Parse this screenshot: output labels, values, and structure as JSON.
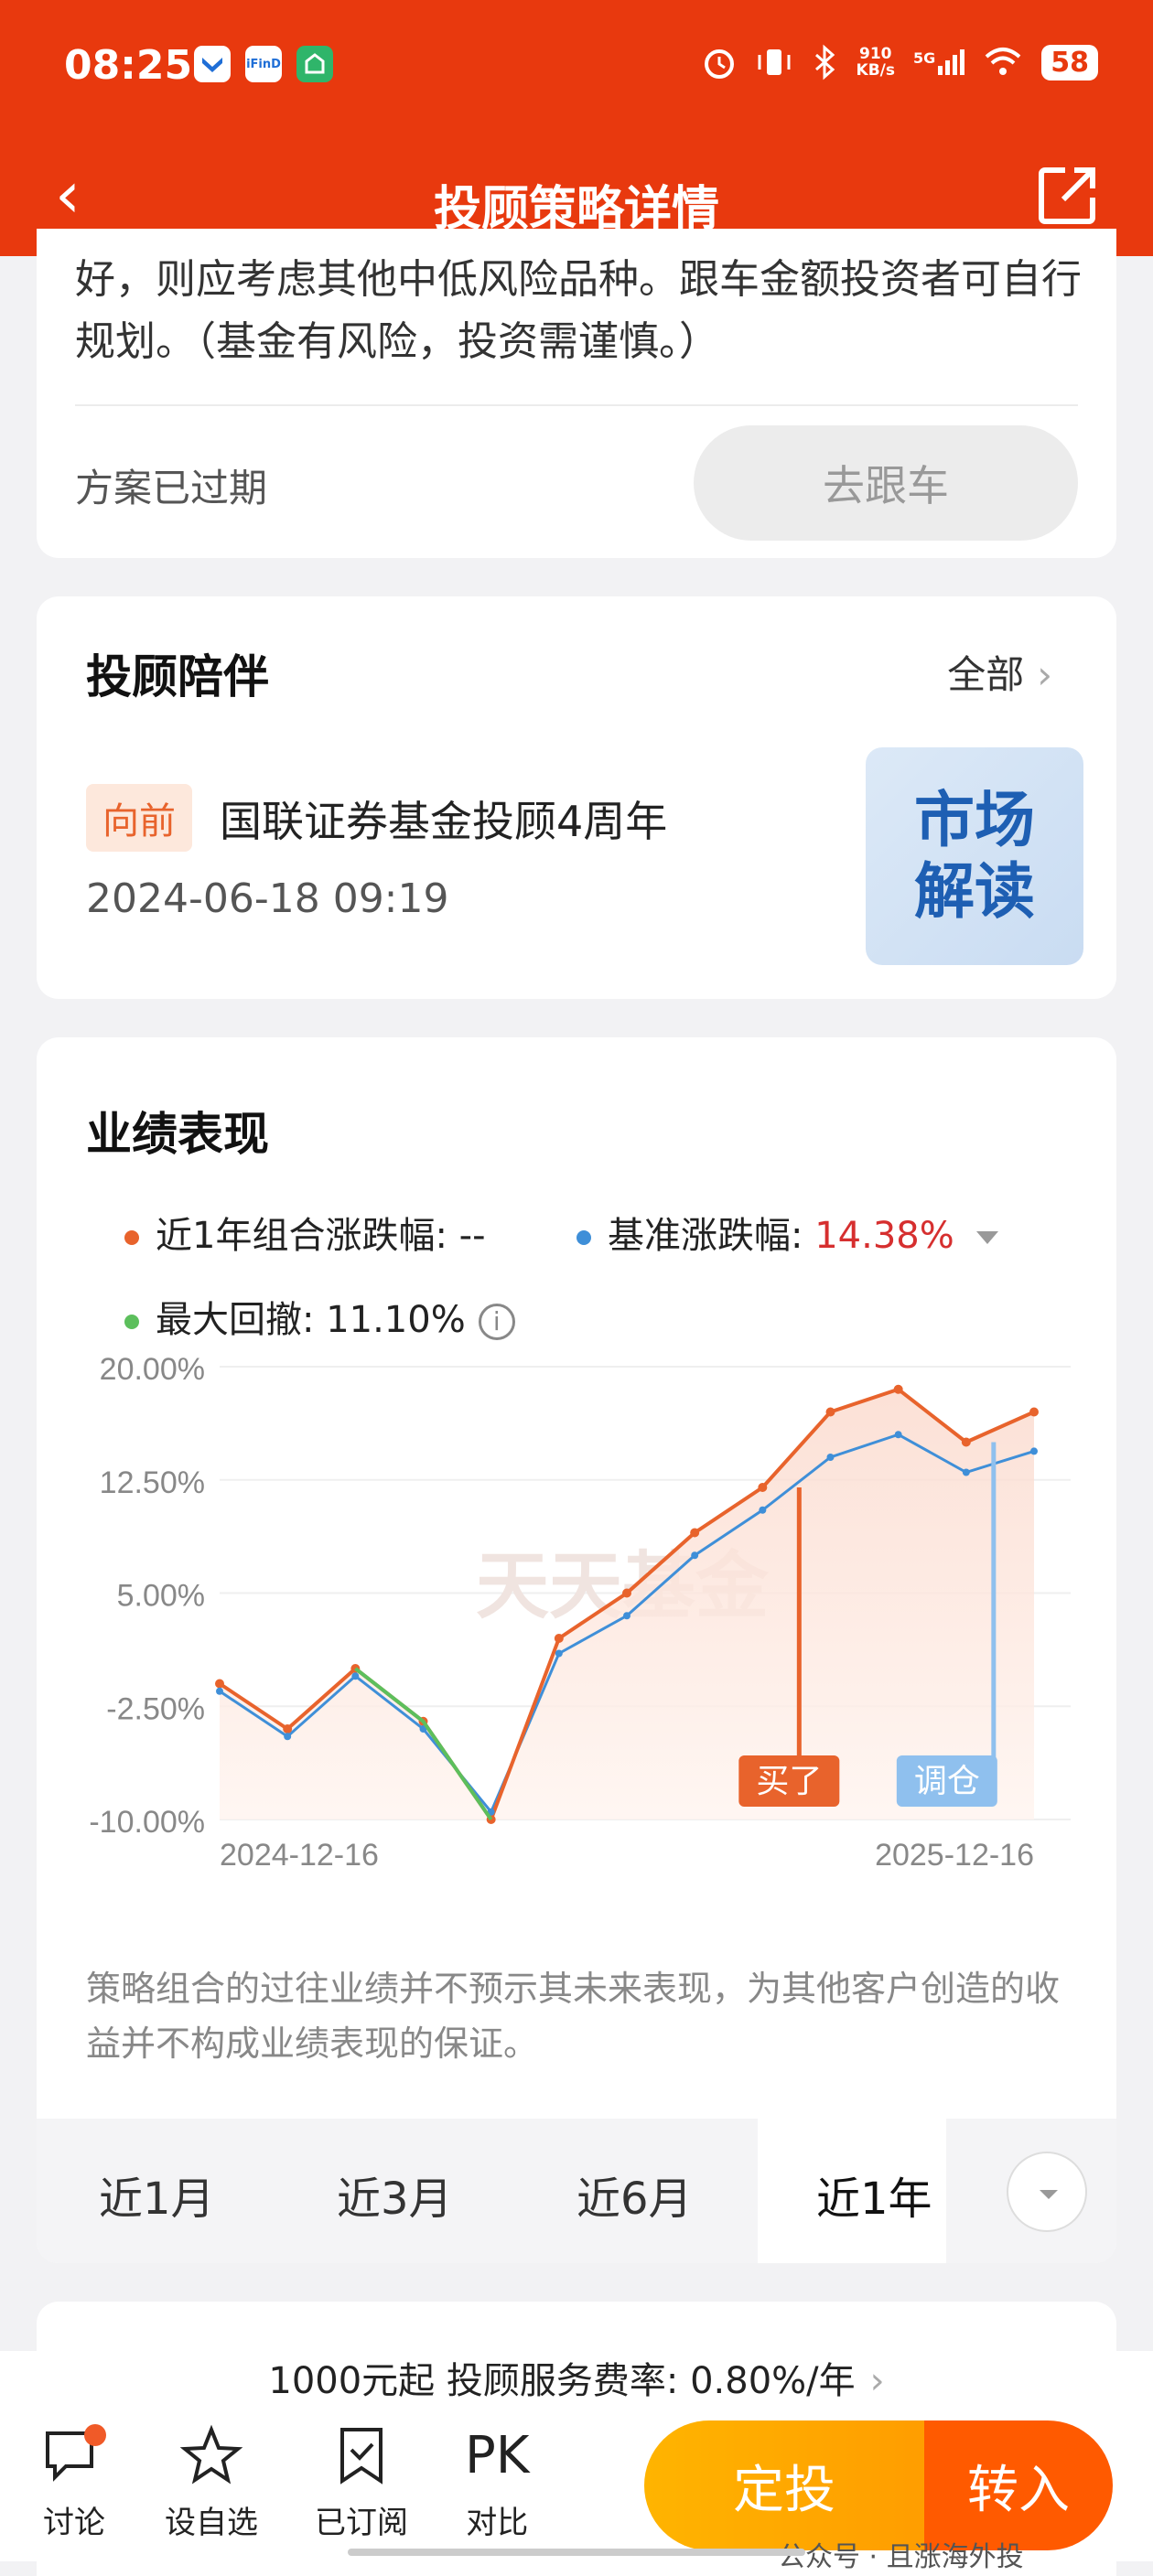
{
  "status": {
    "time": "08:25",
    "speed_value": "910",
    "speed_unit": "KB/s",
    "network": "5G",
    "battery": "58",
    "icons": [
      "app-blue-icon",
      "ifind-app-icon",
      "green-app-icon",
      "alarm-icon",
      "vibrate-icon",
      "bluetooth-icon",
      "signal-icon",
      "wifi-icon"
    ]
  },
  "nav": {
    "title": "投顾策略详情",
    "back_icon": "back-icon",
    "share_icon": "share-icon"
  },
  "plan": {
    "description": "好，则应考虑其他中低风险品种。跟车金额投资者可自行规划。（基金有风险，投资需谨慎。）",
    "status": "方案已过期",
    "follow_button": "去跟车"
  },
  "companion": {
    "title": "投顾陪伴",
    "more": "全部",
    "tag": "向前",
    "news_title": "国联证券基金投顾4周年",
    "news_time": "2024-06-18 09:19",
    "thumb_text": "市场解读"
  },
  "performance": {
    "title": "业绩表现",
    "legend_portfolio": "近1年组合涨跌幅: --",
    "legend_benchmark_label": "基准涨跌幅: ",
    "legend_benchmark_value": "14.38%",
    "legend_drawdown": "最大回撤: 11.10%",
    "info_icon": "i",
    "disclaimer": "策略组合的过往业绩并不预示其未来表现，为其他客户创造的收益并不构成业绩表现的保证。",
    "colors": {
      "portfolio": "#e8632c",
      "benchmark": "#3f8fd8",
      "drawdown": "#5cbf5c",
      "negative": "#d62f2f"
    },
    "watermark": "天天基金",
    "buy_label": "买了",
    "rebalance_label": "调仓"
  },
  "chart_data": {
    "type": "line",
    "x": [
      "2024-12-16",
      "2025-01-15",
      "2025-02-15",
      "2025-03-15",
      "2025-04-08",
      "2025-05-15",
      "2025-06-15",
      "2025-07-15",
      "2025-08-15",
      "2025-09-15",
      "2025-10-15",
      "2025-11-15",
      "2025-12-16"
    ],
    "series": [
      {
        "values": [
          -1.0,
          -4.0,
          0.0,
          -3.5,
          -10.0,
          2.0,
          5.0,
          9.0,
          12.0,
          17.0,
          18.5,
          15.0,
          17.0
        ]
      },
      {
        "values": [
          -1.5,
          -4.5,
          -0.5,
          -4.0,
          -9.5,
          1.0,
          3.5,
          7.5,
          10.5,
          14.0,
          15.5,
          13.0,
          14.4
        ]
      }
    ],
    "ylim": [
      -10,
      20
    ],
    "yticks": [
      "20.00%",
      "12.50%",
      "5.00%",
      "-2.50%",
      "-10.00%"
    ],
    "x_start_label": "2024-12-16",
    "x_end_label": "2025-12-16",
    "grid": true
  },
  "period_tabs": [
    "近1月",
    "近3月",
    "近6月",
    "近1年"
  ],
  "active_tab": "近1年",
  "footer": {
    "fee": "1000元起   投顾服务费率: 0.80%/年",
    "items": [
      "讨论",
      "设自选",
      "已订阅",
      "对比"
    ],
    "pk": "PK",
    "invest_button": "定投",
    "transfer_button": "转入",
    "watermark": "公众号 · 且涨海外投"
  }
}
